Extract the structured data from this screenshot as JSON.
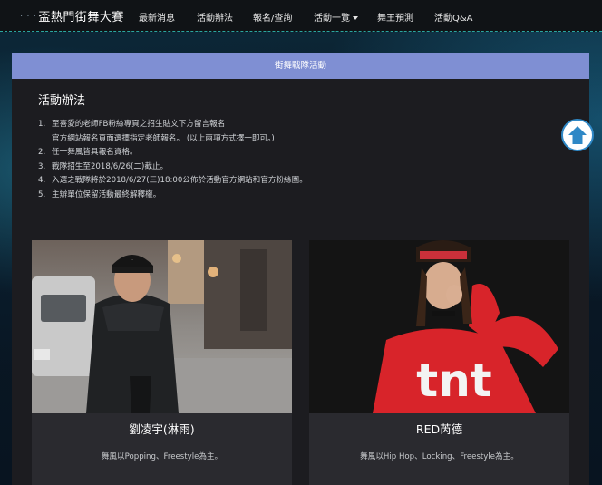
{
  "navbar": {
    "brand_prefix": "· · ·",
    "brand": "盃熱門街舞大賽",
    "items": [
      {
        "label": "最新消息"
      },
      {
        "label": "活動辦法"
      },
      {
        "label": "報名/查詢"
      },
      {
        "label": "活動一覽"
      },
      {
        "label": "舞王預測"
      },
      {
        "label": "活動Q&A"
      }
    ]
  },
  "panel": {
    "header": "街舞戰隊活動",
    "title": "活動辦法",
    "rules": [
      {
        "num": "1.",
        "text": "至喜愛的老師FB粉絲專頁之招生貼文下方留言報名"
      },
      {
        "num": "",
        "text": "官方網站報名頁面選擇指定老師報名。 (以上兩項方式擇一即可。)"
      },
      {
        "num": "2.",
        "text": "任一舞風皆具報名資格。"
      },
      {
        "num": "3.",
        "text": "戰隊招生至2018/6/26(二)截止。"
      },
      {
        "num": "4.",
        "text": "入選之戰隊將於2018/6/27(三)18:00公佈於活動官方網站和官方粉絲團。"
      },
      {
        "num": "5.",
        "text": "主辦單位保留活動最終解釋權。"
      }
    ]
  },
  "cards": [
    {
      "name": "劉凌宇(淋雨)",
      "desc": "舞風以Popping、Freestyle為主。"
    },
    {
      "name": "RED芮德",
      "desc": "舞風以Hip Hop、Locking、Freestyle為主。"
    }
  ],
  "photo_text": {
    "shirt": "tnt"
  },
  "colors": {
    "navbar_bg": "#101316",
    "panel_header": "#7f8fd3",
    "panel_bg": "#1c1c20",
    "card_bg": "#2a2a2f",
    "scroll_button_border": "#2f88c6"
  },
  "icons": {
    "scroll_top": "arrow-up-circle-icon",
    "dropdown": "caret-down-icon"
  }
}
